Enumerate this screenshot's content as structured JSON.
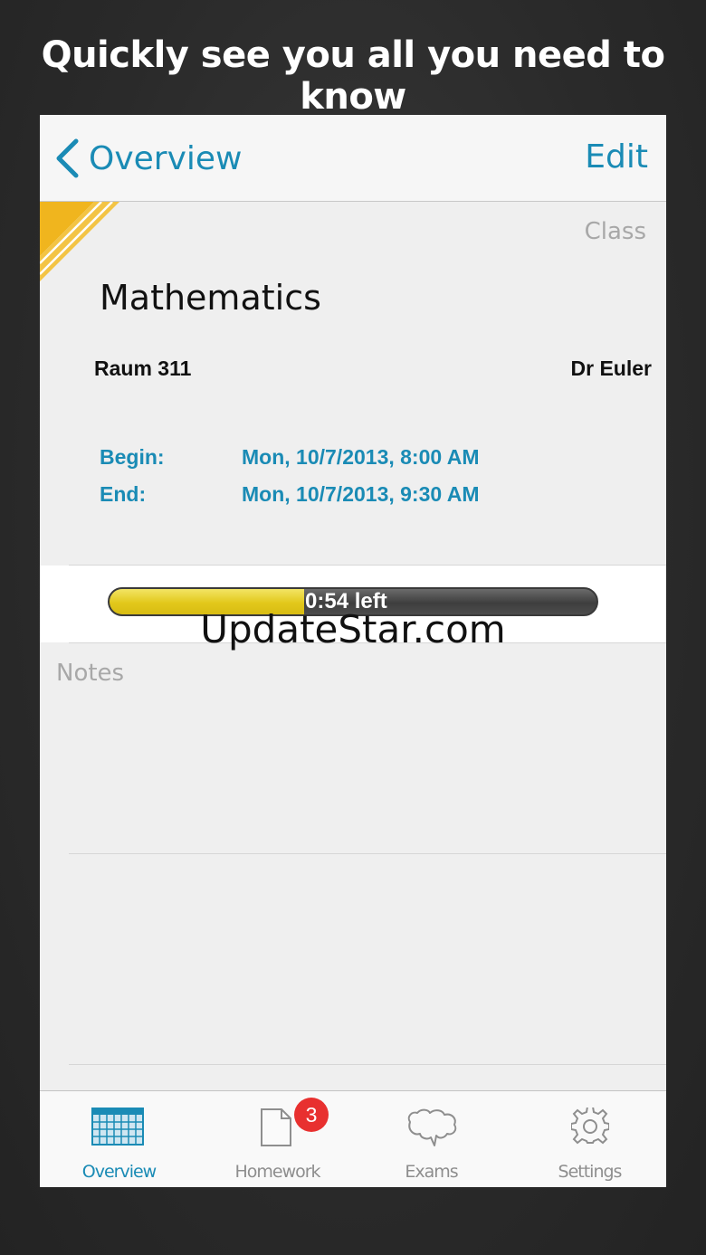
{
  "headline": "Quickly see you all you need to know",
  "nav": {
    "back_label": "Overview",
    "edit_label": "Edit"
  },
  "class_card": {
    "section_label": "Class",
    "subject": "Mathematics",
    "room": "Raum 311",
    "teacher": "Dr Euler",
    "begin_label": "Begin:",
    "begin_value": "Mon, 10/7/2013, 8:00 AM",
    "end_label": "End:",
    "end_value": "Mon, 10/7/2013, 9:30 AM"
  },
  "progress": {
    "text": "0:54 left",
    "fraction_elapsed": 0.4
  },
  "watermark": "UpdateStar.com",
  "notes": {
    "label": "Notes"
  },
  "tabs": [
    {
      "label": "Overview",
      "icon": "calendar-icon",
      "active": true
    },
    {
      "label": "Homework",
      "icon": "document-icon",
      "badge": "3"
    },
    {
      "label": "Exams",
      "icon": "brain-icon"
    },
    {
      "label": "Settings",
      "icon": "gear-icon"
    }
  ],
  "colors": {
    "accent": "#1a8bb5",
    "ribbon": "#f0b51e",
    "progress_fill": "#e2c81b",
    "badge": "#e8302f",
    "inactive_tab": "#8e8e8e"
  }
}
